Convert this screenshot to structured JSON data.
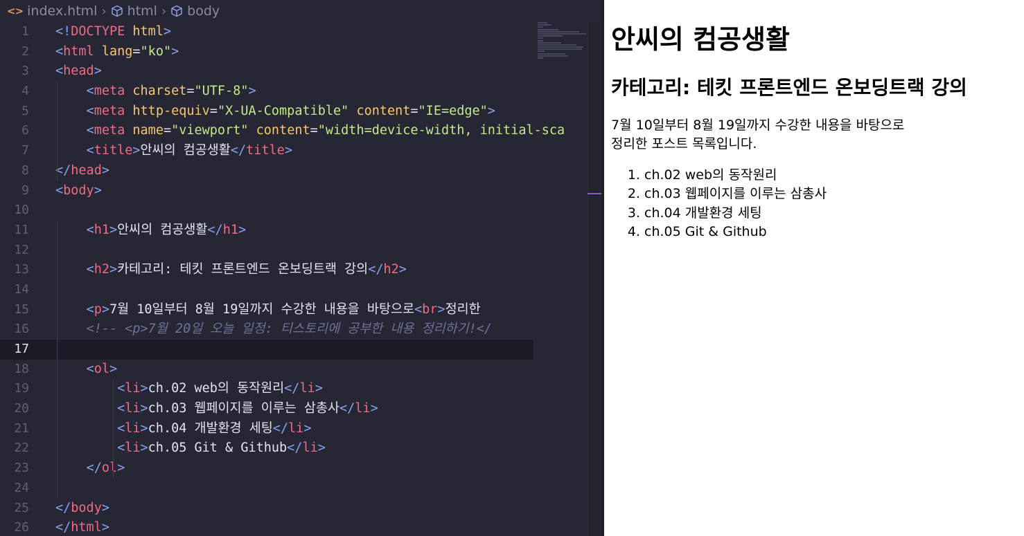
{
  "breadcrumb": {
    "file": "index.html",
    "html": "html",
    "body": "body"
  },
  "editor": {
    "active_line": 17,
    "lines": [
      {
        "n": "1",
        "tokens": [
          [
            "t",
            "<!"
          ],
          [
            "n",
            "DOCTYPE"
          ],
          [
            "w",
            " "
          ],
          [
            "a",
            "html"
          ],
          [
            "t",
            ">"
          ]
        ]
      },
      {
        "n": "2",
        "tokens": [
          [
            "t",
            "<"
          ],
          [
            "n",
            "html"
          ],
          [
            "w",
            " "
          ],
          [
            "a",
            "lang"
          ],
          [
            "w",
            "="
          ],
          [
            "s",
            "\"ko\""
          ],
          [
            "t",
            ">"
          ]
        ]
      },
      {
        "n": "3",
        "tokens": [
          [
            "t",
            "<"
          ],
          [
            "n",
            "head"
          ],
          [
            "t",
            ">"
          ]
        ]
      },
      {
        "n": "4",
        "tokens": [
          [
            "w",
            "    "
          ],
          [
            "t",
            "<"
          ],
          [
            "n",
            "meta"
          ],
          [
            "w",
            " "
          ],
          [
            "a",
            "charset"
          ],
          [
            "w",
            "="
          ],
          [
            "s",
            "\"UTF-8\""
          ],
          [
            "t",
            ">"
          ]
        ]
      },
      {
        "n": "5",
        "tokens": [
          [
            "w",
            "    "
          ],
          [
            "t",
            "<"
          ],
          [
            "n",
            "meta"
          ],
          [
            "w",
            " "
          ],
          [
            "a",
            "http-equiv"
          ],
          [
            "w",
            "="
          ],
          [
            "s",
            "\"X-UA-Compatible\""
          ],
          [
            "w",
            " "
          ],
          [
            "a",
            "content"
          ],
          [
            "w",
            "="
          ],
          [
            "s",
            "\"IE=edge\""
          ],
          [
            "t",
            ">"
          ]
        ]
      },
      {
        "n": "6",
        "tokens": [
          [
            "w",
            "    "
          ],
          [
            "t",
            "<"
          ],
          [
            "n",
            "meta"
          ],
          [
            "w",
            " "
          ],
          [
            "a",
            "name"
          ],
          [
            "w",
            "="
          ],
          [
            "s",
            "\"viewport\""
          ],
          [
            "w",
            " "
          ],
          [
            "a",
            "content"
          ],
          [
            "w",
            "="
          ],
          [
            "s",
            "\"width=device-width, initial-sca"
          ]
        ]
      },
      {
        "n": "7",
        "tokens": [
          [
            "w",
            "    "
          ],
          [
            "t",
            "<"
          ],
          [
            "n",
            "title"
          ],
          [
            "t",
            ">"
          ],
          [
            "w",
            "안씨의 컴공생활"
          ],
          [
            "t",
            "</"
          ],
          [
            "n",
            "title"
          ],
          [
            "t",
            ">"
          ]
        ]
      },
      {
        "n": "8",
        "tokens": [
          [
            "t",
            "</"
          ],
          [
            "n",
            "head"
          ],
          [
            "t",
            ">"
          ]
        ]
      },
      {
        "n": "9",
        "tokens": [
          [
            "t",
            "<"
          ],
          [
            "n",
            "body"
          ],
          [
            "t",
            ">"
          ]
        ]
      },
      {
        "n": "10",
        "tokens": []
      },
      {
        "n": "11",
        "tokens": [
          [
            "w",
            "    "
          ],
          [
            "t",
            "<"
          ],
          [
            "n",
            "h1"
          ],
          [
            "t",
            ">"
          ],
          [
            "w",
            "안씨의 컴공생활"
          ],
          [
            "t",
            "</"
          ],
          [
            "n",
            "h1"
          ],
          [
            "t",
            ">"
          ]
        ]
      },
      {
        "n": "12",
        "tokens": []
      },
      {
        "n": "13",
        "tokens": [
          [
            "w",
            "    "
          ],
          [
            "t",
            "<"
          ],
          [
            "n",
            "h2"
          ],
          [
            "t",
            ">"
          ],
          [
            "w",
            "카테고리: 테킷 프론트엔드 온보딩트랙 강의"
          ],
          [
            "t",
            "</"
          ],
          [
            "n",
            "h2"
          ],
          [
            "t",
            ">"
          ]
        ]
      },
      {
        "n": "14",
        "tokens": []
      },
      {
        "n": "15",
        "tokens": [
          [
            "w",
            "    "
          ],
          [
            "t",
            "<"
          ],
          [
            "n",
            "p"
          ],
          [
            "t",
            ">"
          ],
          [
            "w",
            "7월 10일부터 8월 19일까지 수강한 내용을 바탕으로"
          ],
          [
            "t",
            "<"
          ],
          [
            "n",
            "br"
          ],
          [
            "t",
            ">"
          ],
          [
            "w",
            "정리한"
          ]
        ]
      },
      {
        "n": "16",
        "tokens": [
          [
            "w",
            "    "
          ],
          [
            "c",
            "<!-- <p>7월 20일 오늘 일정: 티스토리에 공부한 내용 정리하기!</"
          ]
        ]
      },
      {
        "n": "17",
        "tokens": []
      },
      {
        "n": "18",
        "tokens": [
          [
            "w",
            "    "
          ],
          [
            "t",
            "<"
          ],
          [
            "n",
            "ol"
          ],
          [
            "t",
            ">"
          ]
        ]
      },
      {
        "n": "19",
        "tokens": [
          [
            "w",
            "        "
          ],
          [
            "t",
            "<"
          ],
          [
            "n",
            "li"
          ],
          [
            "t",
            ">"
          ],
          [
            "w",
            "ch.02 web의 동작원리"
          ],
          [
            "t",
            "</"
          ],
          [
            "n",
            "li"
          ],
          [
            "t",
            ">"
          ]
        ]
      },
      {
        "n": "20",
        "tokens": [
          [
            "w",
            "        "
          ],
          [
            "t",
            "<"
          ],
          [
            "n",
            "li"
          ],
          [
            "t",
            ">"
          ],
          [
            "w",
            "ch.03 웹페이지를 이루는 삼총사"
          ],
          [
            "t",
            "</"
          ],
          [
            "n",
            "li"
          ],
          [
            "t",
            ">"
          ]
        ]
      },
      {
        "n": "21",
        "tokens": [
          [
            "w",
            "        "
          ],
          [
            "t",
            "<"
          ],
          [
            "n",
            "li"
          ],
          [
            "t",
            ">"
          ],
          [
            "w",
            "ch.04 개발환경 세팅"
          ],
          [
            "t",
            "</"
          ],
          [
            "n",
            "li"
          ],
          [
            "t",
            ">"
          ]
        ]
      },
      {
        "n": "22",
        "tokens": [
          [
            "w",
            "        "
          ],
          [
            "t",
            "<"
          ],
          [
            "n",
            "li"
          ],
          [
            "t",
            ">"
          ],
          [
            "w",
            "ch.05 Git & Github"
          ],
          [
            "t",
            "</"
          ],
          [
            "n",
            "li"
          ],
          [
            "t",
            ">"
          ]
        ]
      },
      {
        "n": "23",
        "tokens": [
          [
            "w",
            "    "
          ],
          [
            "t",
            "</"
          ],
          [
            "n",
            "ol"
          ],
          [
            "t",
            ">"
          ]
        ]
      },
      {
        "n": "24",
        "tokens": []
      },
      {
        "n": "25",
        "tokens": [
          [
            "t",
            "</"
          ],
          [
            "n",
            "body"
          ],
          [
            "t",
            ">"
          ]
        ]
      },
      {
        "n": "26",
        "tokens": [
          [
            "t",
            "</"
          ],
          [
            "n",
            "html"
          ],
          [
            "t",
            ">"
          ]
        ]
      }
    ]
  },
  "preview": {
    "h1": "안씨의 컴공생활",
    "h2": "카테고리: 테킷 프론트엔드 온보딩트랙 강의",
    "p_line1": "7월 10일부터 8월 19일까지 수강한 내용을 바탕으로",
    "p_line2": "정리한 포스트 목록입니다.",
    "list": [
      "ch.02 web의 동작원리",
      "ch.03 웹페이지를 이루는 삼총사",
      "ch.04 개발환경 세팅",
      "ch.05 Git & Github"
    ]
  },
  "colors": {
    "editor_bg": "#262634",
    "tag_bracket": "#88a3f0",
    "tag_name": "#f06b85",
    "attribute": "#f7c76e",
    "string": "#c3e88d",
    "comment": "#6e7196",
    "scroll_marker": "#7c62c9"
  }
}
